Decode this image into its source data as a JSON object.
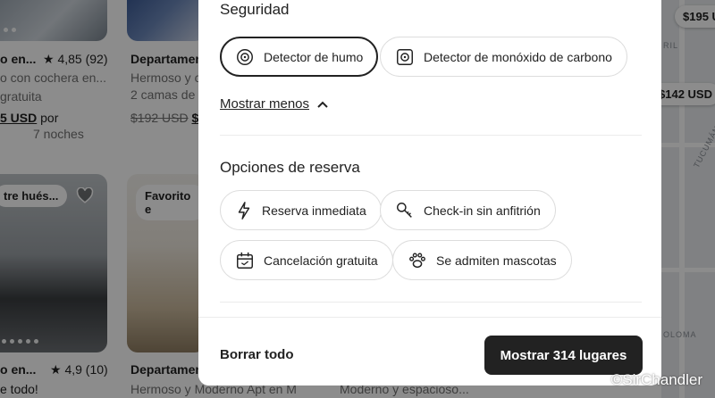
{
  "background": {
    "listings": [
      {
        "title": "o en...",
        "rating": "★ 4,85 (92)",
        "line2": "o con cochera en...",
        "line3": "gratuita",
        "price_old": "",
        "price": "5 USD",
        "per": "por",
        "nights": "7 noches"
      },
      {
        "title": "Departamen",
        "line2": "Hermoso y c",
        "line3": "2 camas de",
        "price_old": "$192 USD",
        "price": "$1"
      },
      {
        "title": "o en...",
        "rating": "★ 4,9 (10)",
        "line2": "e todo!"
      },
      {
        "title": "Departamen",
        "line2": "Hermoso y Moderno Apt en M"
      }
    ],
    "badge_guest": "tre hués...",
    "badge_favorite": "Favorito e",
    "bottom_text_right": "Moderno y espacioso...",
    "map": {
      "price_pills": [
        "$195 U",
        "$142 USD"
      ],
      "labels": [
        "RIL",
        "TUCUMÁN",
        "OLOMA"
      ],
      "google": "Google"
    },
    "watermark": "©SirChandler"
  },
  "modal": {
    "security": {
      "title": "Seguridad",
      "chips": [
        {
          "label": "Detector de humo",
          "icon": "smoke-detector-icon",
          "selected": true
        },
        {
          "label": "Detector de monóxido de carbono",
          "icon": "co-detector-icon",
          "selected": false
        }
      ],
      "show_less": "Mostrar menos"
    },
    "booking": {
      "title": "Opciones de reserva",
      "chips": [
        {
          "label": "Reserva inmediata",
          "icon": "lightning-icon"
        },
        {
          "label": "Check-in sin anfitrión",
          "icon": "key-icon"
        },
        {
          "label": "Cancelación gratuita",
          "icon": "calendar-icon"
        },
        {
          "label": "Se admiten mascotas",
          "icon": "paw-icon"
        }
      ]
    },
    "footer": {
      "clear": "Borrar todo",
      "show": "Mostrar 314 lugares"
    }
  }
}
